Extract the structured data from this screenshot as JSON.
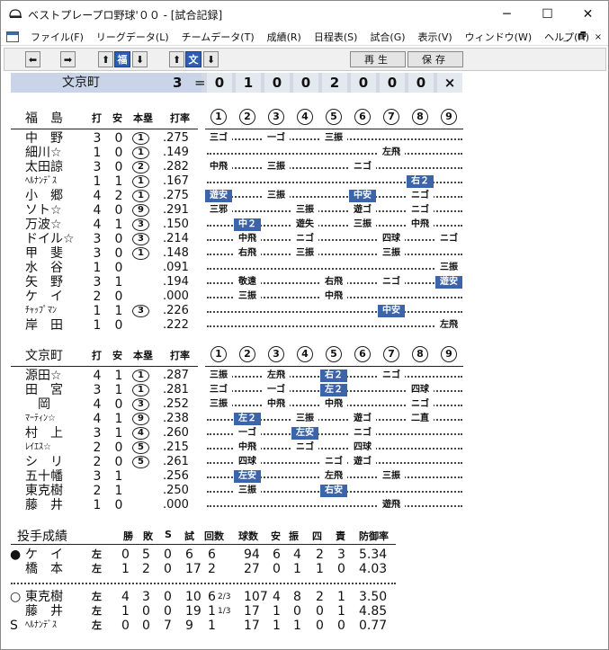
{
  "window": {
    "title": "ベストプレープロ野球'００ - [試合記録]",
    "minimize": "─",
    "maximize": "☐",
    "close": "✕"
  },
  "menu": {
    "items": [
      "ファイル(F)",
      "リーグデータ(L)",
      "チームデータ(T)",
      "成績(R)",
      "日程表(S)",
      "試合(G)",
      "表示(V)",
      "ウィンドウ(W)",
      "ヘルプ(H)"
    ],
    "mdi_min": "_",
    "mdi_restore": "🗗",
    "mdi_close": "×"
  },
  "toolbar": {
    "prev": "⬅",
    "next": "➡",
    "up": "⬆",
    "down": "⬇",
    "team1": "福",
    "team2": "文",
    "play_label": "再生",
    "save_label": "保存"
  },
  "scoreboard": {
    "team": "文京町",
    "score": "3",
    "eq": "=",
    "innings": [
      "0",
      "1",
      "0",
      "0",
      "2",
      "0",
      "0",
      "0",
      "×"
    ]
  },
  "headers": {
    "ab": "打",
    "h": "安",
    "hr": "本塁",
    "avg": "打率",
    "innings": [
      "1",
      "2",
      "3",
      "4",
      "5",
      "6",
      "7",
      "8",
      "9"
    ]
  },
  "fukushima": {
    "team": "福　島",
    "batters": [
      {
        "name": "中　野",
        "ab": "3",
        "h": "0",
        "hr": "1",
        "avg": ".275",
        "results": [
          {
            "i": 1,
            "t": "三ゴ"
          },
          {
            "i": 3,
            "t": "一ゴ"
          },
          {
            "i": 5,
            "t": "三振"
          }
        ]
      },
      {
        "name": "細川☆",
        "ab": "1",
        "h": "0",
        "hr": "1",
        "avg": ".149",
        "results": [
          {
            "i": 7,
            "t": "左飛"
          }
        ]
      },
      {
        "name": "太田諒",
        "ab": "3",
        "h": "0",
        "hr": "2",
        "avg": ".282",
        "results": [
          {
            "i": 1,
            "t": "中飛"
          },
          {
            "i": 3,
            "t": "三振"
          },
          {
            "i": 6,
            "t": "ニゴ"
          }
        ]
      },
      {
        "name": "ﾍﾙﾅﾝﾃﾞｽ",
        "sm": true,
        "ab": "1",
        "h": "1",
        "hr": "1",
        "avg": ".167",
        "results": [
          {
            "i": 8,
            "t": "右２",
            "hit": true
          }
        ]
      },
      {
        "name": "小　郷",
        "ab": "4",
        "h": "2",
        "hr": "1",
        "avg": ".275",
        "results": [
          {
            "i": 1,
            "t": "遊安",
            "hit": true
          },
          {
            "i": 3,
            "t": "三振"
          },
          {
            "i": 6,
            "t": "中安",
            "hit": true
          },
          {
            "i": 8,
            "t": "ニゴ"
          }
        ]
      },
      {
        "name": "ソト☆",
        "ab": "4",
        "h": "0",
        "hr": "9",
        "avg": ".291",
        "results": [
          {
            "i": 1,
            "t": "三邪"
          },
          {
            "i": 4,
            "t": "三振"
          },
          {
            "i": 6,
            "t": "遊ゴ"
          },
          {
            "i": 8,
            "t": "ニゴ"
          }
        ]
      },
      {
        "name": "万波☆",
        "ab": "4",
        "h": "1",
        "hr": "3",
        "avg": ".150",
        "results": [
          {
            "i": 2,
            "t": "中２",
            "hit": true
          },
          {
            "i": 4,
            "t": "遊失"
          },
          {
            "i": 6,
            "t": "三振"
          },
          {
            "i": 8,
            "t": "中飛"
          }
        ]
      },
      {
        "name": "ドイル☆",
        "ab": "3",
        "h": "0",
        "hr": "3",
        "avg": ".214",
        "results": [
          {
            "i": 2,
            "t": "中飛"
          },
          {
            "i": 4,
            "t": "ニゴ"
          },
          {
            "i": 7,
            "t": "四球"
          },
          {
            "i": 9,
            "t": "ニゴ"
          }
        ]
      },
      {
        "name": "甲　斐",
        "ab": "3",
        "h": "0",
        "hr": "1",
        "avg": ".148",
        "results": [
          {
            "i": 2,
            "t": "右飛"
          },
          {
            "i": 4,
            "t": "三振"
          },
          {
            "i": 7,
            "t": "三振"
          }
        ]
      },
      {
        "name": "水　谷",
        "ab": "1",
        "h": "0",
        "hr": "",
        "avg": ".091",
        "results": [
          {
            "i": 9,
            "t": "三振"
          }
        ]
      },
      {
        "name": "矢　野",
        "ab": "3",
        "h": "1",
        "hr": "",
        "avg": ".194",
        "results": [
          {
            "i": 2,
            "t": "敬遠"
          },
          {
            "i": 5,
            "t": "右飛"
          },
          {
            "i": 7,
            "t": "ニゴ"
          },
          {
            "i": 9,
            "t": "遊安",
            "hit": true
          }
        ]
      },
      {
        "name": "ケ　イ",
        "ab": "2",
        "h": "0",
        "hr": "",
        "avg": ".000",
        "results": [
          {
            "i": 2,
            "t": "三振"
          },
          {
            "i": 5,
            "t": "中飛"
          }
        ]
      },
      {
        "name": "ﾁｬｯﾌﾟﾏﾝ",
        "sm": true,
        "ab": "1",
        "h": "1",
        "hr": "3",
        "avg": ".226",
        "results": [
          {
            "i": 7,
            "t": "中安",
            "hit": true
          }
        ]
      },
      {
        "name": "岸　田",
        "ab": "1",
        "h": "0",
        "hr": "",
        "avg": ".222",
        "results": [
          {
            "i": 9,
            "t": "左飛"
          }
        ]
      }
    ]
  },
  "bunkyo": {
    "team": "文京町",
    "batters": [
      {
        "name": "源田☆",
        "ab": "4",
        "h": "1",
        "hr": "1",
        "avg": ".287",
        "results": [
          {
            "i": 1,
            "t": "三振"
          },
          {
            "i": 3,
            "t": "左飛"
          },
          {
            "i": 5,
            "t": "右２",
            "hit": true
          },
          {
            "i": 7,
            "t": "ニゴ"
          }
        ]
      },
      {
        "name": "田　宮",
        "ab": "3",
        "h": "1",
        "hr": "1",
        "avg": ".281",
        "results": [
          {
            "i": 1,
            "t": "三ゴ"
          },
          {
            "i": 3,
            "t": "一ゴ"
          },
          {
            "i": 5,
            "t": "左２",
            "hit": true
          },
          {
            "i": 8,
            "t": "四球"
          }
        ]
      },
      {
        "name": "　岡",
        "ab": "4",
        "h": "0",
        "hr": "3",
        "avg": ".252",
        "results": [
          {
            "i": 1,
            "t": "三振"
          },
          {
            "i": 3,
            "t": "中飛"
          },
          {
            "i": 5,
            "t": "中飛"
          },
          {
            "i": 8,
            "t": "ニゴ"
          }
        ]
      },
      {
        "name": "ﾏｰﾃｨﾝ☆",
        "sm": true,
        "ab": "4",
        "h": "1",
        "hr": "9",
        "avg": ".238",
        "results": [
          {
            "i": 2,
            "t": "左２",
            "hit": true
          },
          {
            "i": 4,
            "t": "三振"
          },
          {
            "i": 6,
            "t": "遊ゴ"
          },
          {
            "i": 8,
            "t": "二直"
          }
        ]
      },
      {
        "name": "村　上",
        "ab": "3",
        "h": "1",
        "hr": "4",
        "avg": ".260",
        "results": [
          {
            "i": 2,
            "t": "一ゴ"
          },
          {
            "i": 4,
            "t": "左安",
            "hit": true
          },
          {
            "i": 6,
            "t": "ニゴ"
          }
        ]
      },
      {
        "name": "ﾚｲｴｽ☆",
        "sm": true,
        "ab": "2",
        "h": "0",
        "hr": "5",
        "avg": ".215",
        "results": [
          {
            "i": 2,
            "t": "中飛"
          },
          {
            "i": 4,
            "t": "ニゴ"
          },
          {
            "i": 6,
            "t": "四球"
          }
        ]
      },
      {
        "name": "シ　リ",
        "ab": "2",
        "h": "0",
        "hr": "5",
        "avg": ".261",
        "results": [
          {
            "i": 2,
            "t": "四球"
          },
          {
            "i": 5,
            "t": "ニゴ"
          },
          {
            "i": 6,
            "t": "遊ゴ"
          }
        ]
      },
      {
        "name": "五十幡",
        "ab": "3",
        "h": "1",
        "hr": "",
        "avg": ".256",
        "results": [
          {
            "i": 2,
            "t": "左安",
            "hit": true
          },
          {
            "i": 5,
            "t": "左飛"
          },
          {
            "i": 7,
            "t": "三振"
          }
        ]
      },
      {
        "name": "東克樹",
        "ab": "2",
        "h": "1",
        "hr": "",
        "avg": ".250",
        "results": [
          {
            "i": 2,
            "t": "三振"
          },
          {
            "i": 5,
            "t": "右安",
            "hit": true
          }
        ]
      },
      {
        "name": "藤　井",
        "ab": "1",
        "h": "0",
        "hr": "",
        "avg": ".000",
        "results": [
          {
            "i": 7,
            "t": "遊飛"
          }
        ]
      }
    ]
  },
  "pitching": {
    "title": "投手成績",
    "headers": [
      "勝",
      "敗",
      "S",
      "試",
      "回数",
      "球数",
      "安",
      "振",
      "四",
      "責",
      "防御率"
    ],
    "fukushima": [
      {
        "mark": "●",
        "name": "ケ　イ",
        "hand": "左",
        "w": "0",
        "l": "5",
        "s": "0",
        "g": "6",
        "ip": "6",
        "ipf": "",
        "np": "94",
        "h": "6",
        "k": "4",
        "bb": "2",
        "er": "3",
        "era": "5.34"
      },
      {
        "mark": "",
        "name": "橋　本",
        "hand": "左",
        "w": "1",
        "l": "2",
        "s": "0",
        "g": "17",
        "ip": "2",
        "ipf": "",
        "np": "27",
        "h": "0",
        "k": "1",
        "bb": "1",
        "er": "0",
        "era": "4.03"
      }
    ],
    "bunkyo": [
      {
        "mark": "○",
        "name": "東克樹",
        "hand": "左",
        "w": "4",
        "l": "3",
        "s": "0",
        "g": "10",
        "ip": "6",
        "ipf": "2/3",
        "np": "107",
        "h": "4",
        "k": "8",
        "bb": "2",
        "er": "1",
        "era": "3.50"
      },
      {
        "mark": "",
        "name": "藤　井",
        "hand": "左",
        "w": "1",
        "l": "0",
        "s": "0",
        "g": "19",
        "ip": "1",
        "ipf": "1/3",
        "np": "17",
        "h": "1",
        "k": "0",
        "bb": "0",
        "er": "1",
        "era": "4.85"
      },
      {
        "mark": "S",
        "name": "ﾍﾙﾅﾝﾃﾞｽ",
        "sm": true,
        "hand": "左",
        "w": "0",
        "l": "0",
        "s": "7",
        "g": "9",
        "ip": "1",
        "ipf": "",
        "np": "17",
        "h": "1",
        "k": "1",
        "bb": "0",
        "er": "0",
        "era": "0.77"
      }
    ]
  }
}
